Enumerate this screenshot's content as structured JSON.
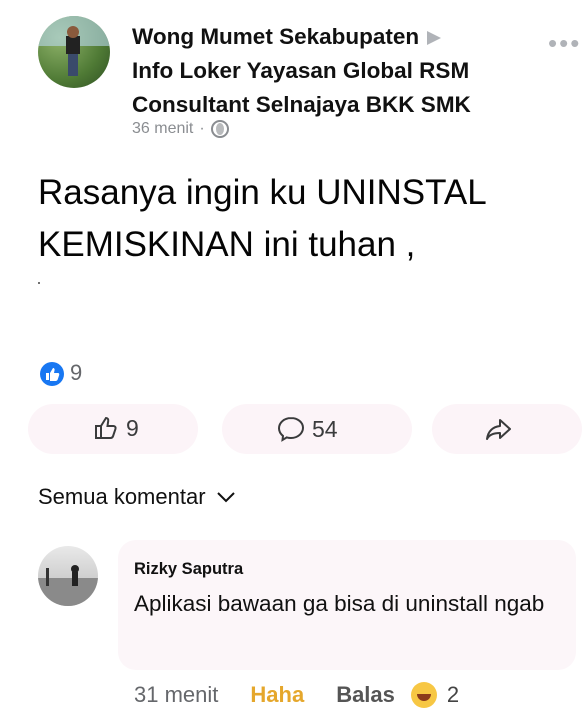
{
  "post": {
    "author_lines": [
      "Wong Mumet Sekabupaten",
      "Info Loker Yayasan Global RSM",
      "Consultant Selnajaya BKK SMK"
    ],
    "time": "36 menit",
    "separator": "·",
    "text": "Rasanya ingin ku UNINSTAL KEMISKINAN ini tuhan ,",
    "reaction_count": "9"
  },
  "actions": {
    "like_count": "9",
    "comment_count": "54"
  },
  "comments_header": {
    "sort_label": "Semua komentar"
  },
  "comment": {
    "name": "Rizky Saputra",
    "text": "Aplikasi bawaan ga bisa di uninstall ngab",
    "time": "31 menit",
    "haha_label": "Haha",
    "reply_label": "Balas",
    "reaction_count": "2"
  },
  "icons": {
    "more": "more-dots-icon",
    "globe": "globe-icon",
    "like": "thumb-up-icon",
    "comment": "comment-bubble-icon",
    "share": "share-arrow-icon",
    "chevron": "chevron-down-icon",
    "haha": "haha-emoji-icon"
  },
  "colors": {
    "accent": "#1877f2",
    "haha": "#e5a72c",
    "muted": "#65676b"
  }
}
